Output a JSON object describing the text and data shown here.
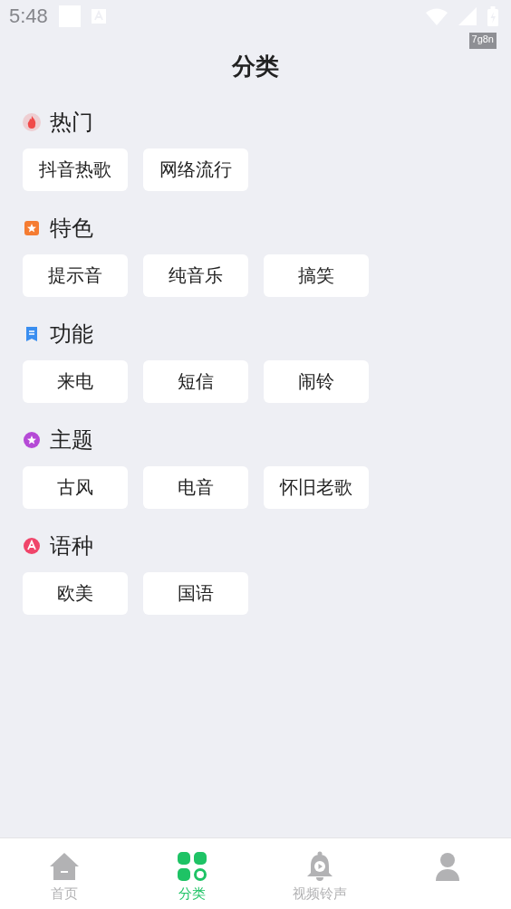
{
  "status_bar": {
    "time": "5:48",
    "tag": "7g8n"
  },
  "title": "分类",
  "sections": [
    {
      "name": "热门",
      "kind": "flame",
      "color": "#f04a4a",
      "items": [
        "抖音热歌",
        "网络流行"
      ]
    },
    {
      "name": "特色",
      "kind": "star",
      "color": "#f57c32",
      "items": [
        "提示音",
        "纯音乐",
        "搞笑"
      ]
    },
    {
      "name": "功能",
      "kind": "bookmark",
      "color": "#3a8ef0",
      "items": [
        "来电",
        "短信",
        "闹铃"
      ]
    },
    {
      "name": "主题",
      "kind": "flower",
      "color": "#b54ad6",
      "items": [
        "古风",
        "电音",
        "怀旧老歌"
      ]
    },
    {
      "name": "语种",
      "kind": "letter",
      "color": "#f0456a",
      "items": [
        "欧美",
        "国语"
      ]
    }
  ],
  "nav": [
    {
      "kind": "home",
      "label": "首页",
      "selected": false
    },
    {
      "kind": "grid",
      "label": "分类",
      "selected": true
    },
    {
      "kind": "bell",
      "label": "视频铃声",
      "selected": false
    },
    {
      "kind": "person",
      "selected": false
    }
  ]
}
